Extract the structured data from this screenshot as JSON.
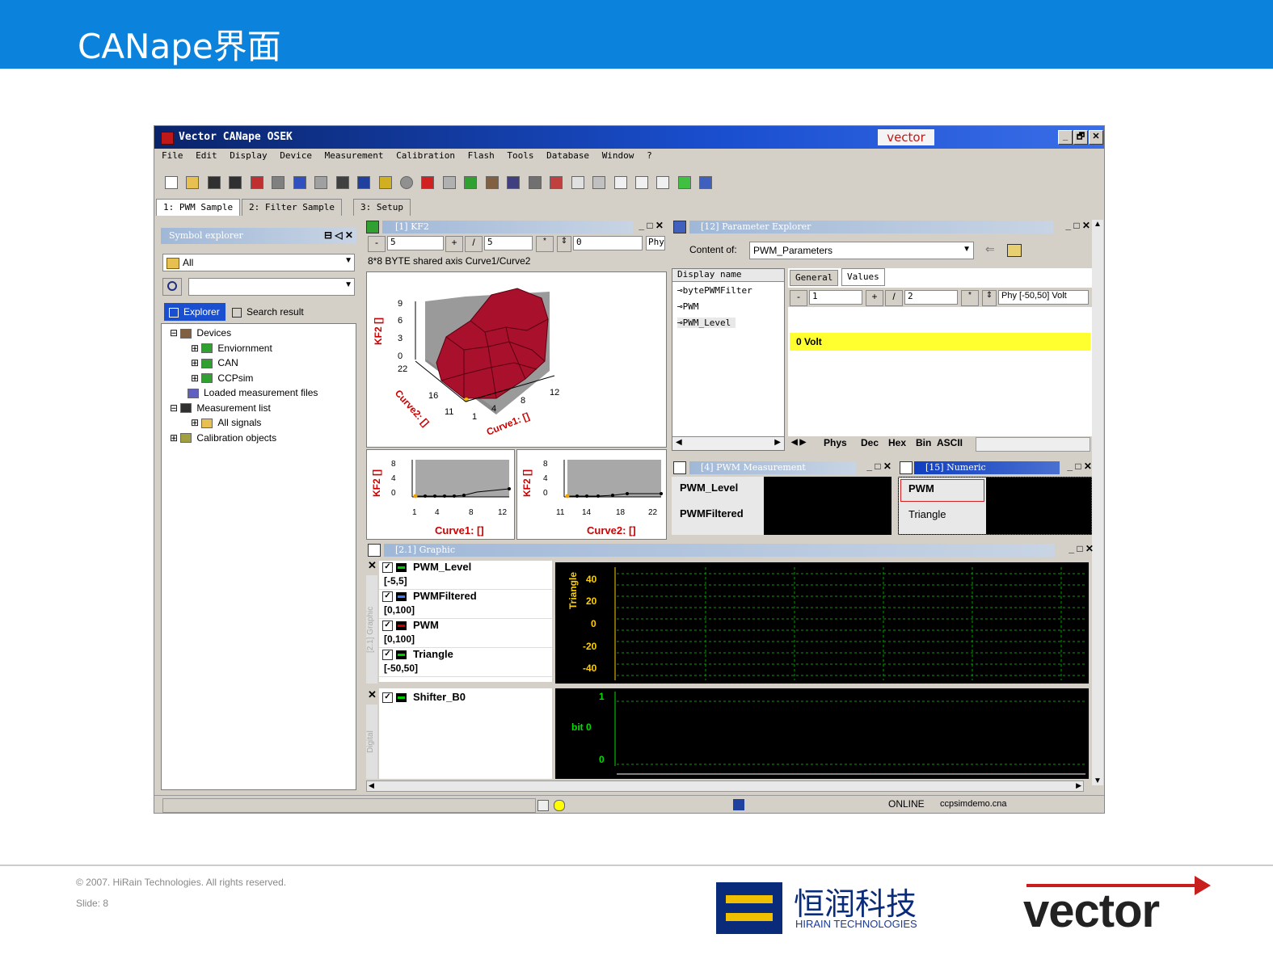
{
  "slide": {
    "title": "CANape界面",
    "footer_copyright": "© 2007. HiRain Technologies. All rights reserved.",
    "footer_slide": "Slide: 8",
    "hirain_cn": "恒润科技",
    "hirain_en": "HIRAIN TECHNOLOGIES",
    "vector_logo": "vector"
  },
  "window": {
    "title": "Vector CANape OSEK",
    "brand": "vector",
    "buttons": [
      "_",
      "🗗",
      "✕"
    ]
  },
  "menu": [
    "File",
    "Edit",
    "Display",
    "Device",
    "Measurement",
    "Calibration",
    "Flash",
    "Tools",
    "Database",
    "Window",
    "?"
  ],
  "tabs": [
    "1: PWM Sample",
    "2: Filter Sample",
    "3: Setup"
  ],
  "symbol_explorer": {
    "title": "Symbol explorer",
    "filter_value": "All",
    "search_value": "",
    "tabs": [
      "Explorer",
      "Search result"
    ],
    "tree": [
      {
        "label": "Devices",
        "level": 0,
        "expander": "⊟"
      },
      {
        "label": "Enviornment",
        "level": 1,
        "expander": "⊞"
      },
      {
        "label": "CAN",
        "level": 1,
        "expander": "⊞"
      },
      {
        "label": "CCPsim",
        "level": 1,
        "expander": "⊞"
      },
      {
        "label": "Loaded measurement files",
        "level": 0,
        "expander": ""
      },
      {
        "label": "Measurement list",
        "level": 0,
        "expander": "⊟"
      },
      {
        "label": "All signals",
        "level": 1,
        "expander": "⊞"
      },
      {
        "label": "Calibration objects",
        "level": 0,
        "expander": "⊞"
      }
    ]
  },
  "kf2_window": {
    "title": "[1] KF2",
    "field1": "5",
    "field2": "5",
    "field3": "0",
    "field4": "Phy",
    "description": "8*8 BYTE shared axis Curve1/Curve2",
    "zlabel": "KF2 []",
    "z_ticks": [
      "9",
      "6",
      "3",
      "0"
    ],
    "curve2_label": "Curve2: []",
    "curve1_label": "Curve1: []",
    "curve2_ticks": [
      "22",
      "16",
      "11"
    ],
    "curve1_ticks": [
      "1",
      "4",
      "8",
      "12"
    ]
  },
  "mini_charts": [
    {
      "ylabel": "KF2 []",
      "y_ticks": [
        "8",
        "4",
        "0"
      ],
      "x_ticks": [
        "1",
        "4",
        "8",
        "12"
      ],
      "xlabel": "Curve1: []"
    },
    {
      "ylabel": "KF2 []",
      "y_ticks": [
        "8",
        "4",
        "0"
      ],
      "x_ticks": [
        "11",
        "14",
        "18",
        "22"
      ],
      "xlabel": "Curve2: []"
    }
  ],
  "param_explorer": {
    "title": "[12] Parameter Explorer",
    "content_label": "Content of:",
    "content_value": "PWM_Parameters",
    "list_header": "Display name",
    "list_items": [
      "bytePWMFilter",
      "PWM",
      "PWM_Level"
    ],
    "tabs": [
      "General",
      "Values"
    ],
    "field1": "1",
    "field2": "2",
    "phy_label": "Phy [-50,50] Volt",
    "value_display": "0 Volt",
    "format_tabs": [
      "Phys",
      "Dec",
      "Hex",
      "Bin",
      "ASCII"
    ]
  },
  "pwm_measurement": {
    "title": "[4] PWM Measurement",
    "signals": [
      "PWM_Level",
      "PWMFiltered"
    ]
  },
  "numeric": {
    "title": "[15] Numeric",
    "signals": [
      "PWM",
      "Triangle"
    ]
  },
  "graphic": {
    "title": "[2.1] Graphic",
    "signals": [
      {
        "name": "PWM_Level",
        "range": "[-5,5]",
        "color": "#00aa00"
      },
      {
        "name": "PWMFiltered",
        "range": "[0,100]",
        "color": "#0044aa"
      },
      {
        "name": "PWM",
        "range": "[0,100]",
        "color": "#cc0000"
      },
      {
        "name": "Triangle",
        "range": "[-50,50]",
        "color": "#00aa00"
      }
    ],
    "yaxis_label": "Triangle",
    "y_ticks": [
      "40",
      "20",
      "0",
      "-20",
      "-40"
    ],
    "side_label": "[2.1] Graphic",
    "digital_signal": "Shifter_B0",
    "digital_axis": "bit 0",
    "digital_ticks": [
      "1",
      "0"
    ],
    "digital_side_label": "Digital"
  },
  "statusbar": {
    "online": "ONLINE",
    "file": "ccpsimdemo.cna"
  }
}
